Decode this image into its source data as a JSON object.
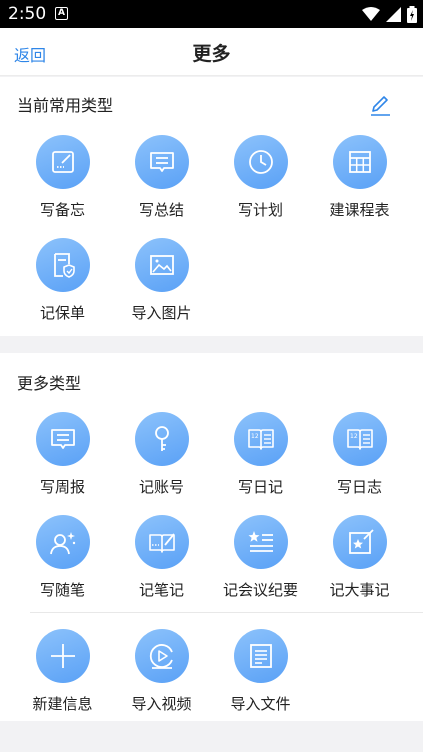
{
  "status": {
    "time": "2:50",
    "notif": "A"
  },
  "nav": {
    "back": "返回",
    "title": "更多"
  },
  "common": {
    "title": "当前常用类型",
    "items": [
      {
        "label": "写备忘",
        "icon": "memo-icon"
      },
      {
        "label": "写总结",
        "icon": "summary-icon"
      },
      {
        "label": "写计划",
        "icon": "clock-icon"
      },
      {
        "label": "建课程表",
        "icon": "timetable-icon"
      },
      {
        "label": "记保单",
        "icon": "policy-icon"
      },
      {
        "label": "导入图片",
        "icon": "image-icon"
      }
    ]
  },
  "more": {
    "title": "更多类型",
    "items": [
      {
        "label": "写周报",
        "icon": "report-icon"
      },
      {
        "label": "记账号",
        "icon": "key-icon"
      },
      {
        "label": "写日记",
        "icon": "diary-icon"
      },
      {
        "label": "写日志",
        "icon": "log-icon"
      },
      {
        "label": "写随笔",
        "icon": "essay-icon"
      },
      {
        "label": "记笔记",
        "icon": "note-icon"
      },
      {
        "label": "记会议纪要",
        "icon": "meeting-icon"
      },
      {
        "label": "记大事记",
        "icon": "event-icon"
      },
      {
        "label": "新建信息",
        "icon": "plus-icon"
      },
      {
        "label": "导入视频",
        "icon": "video-icon"
      },
      {
        "label": "导入文件",
        "icon": "file-icon"
      }
    ]
  },
  "colors": {
    "accent": "#2f86e8",
    "icon_bg": "#6aacf8"
  }
}
